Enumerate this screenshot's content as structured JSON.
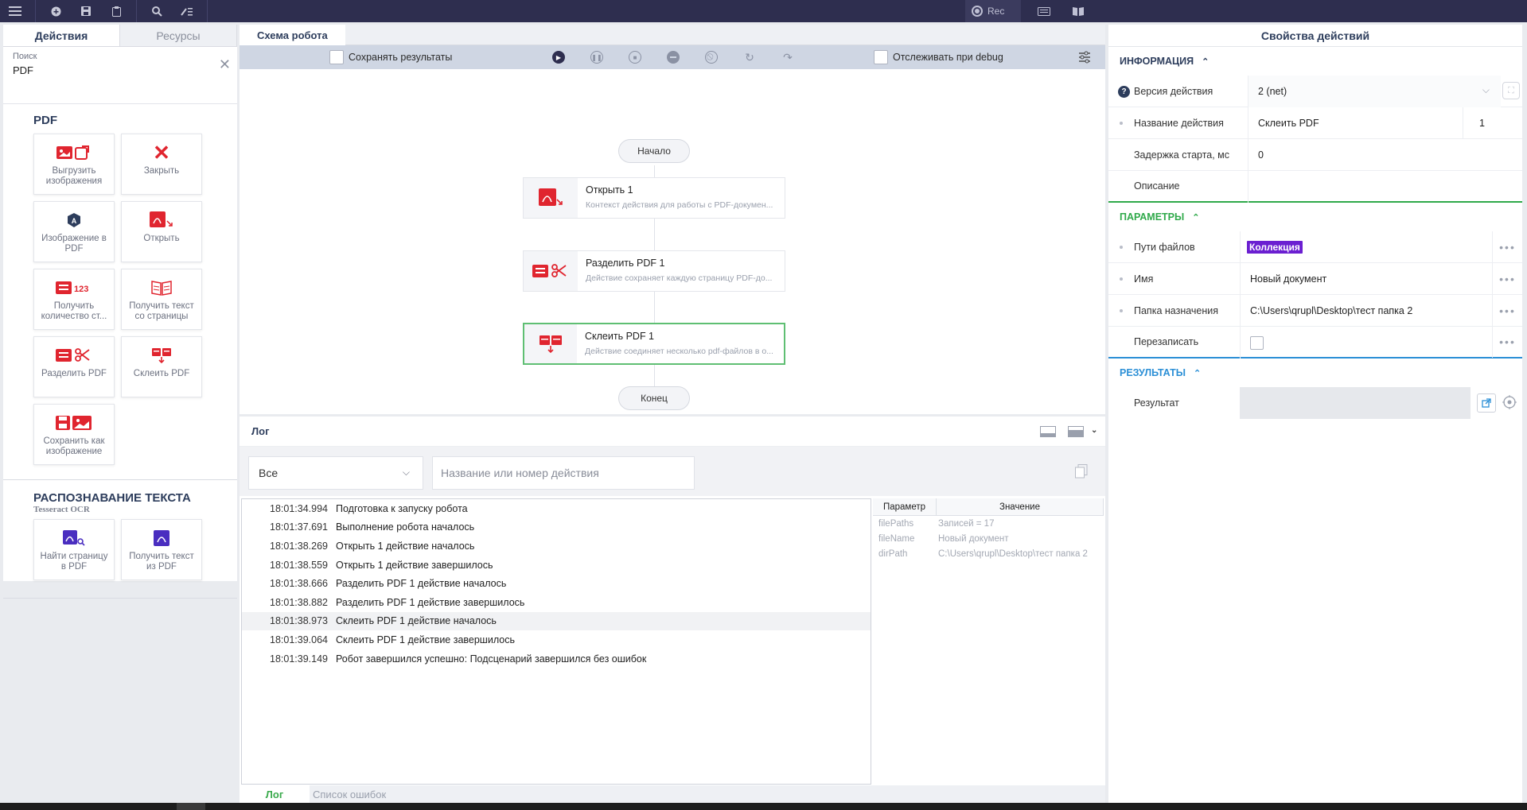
{
  "toolbar": {
    "rec_label": "Rec"
  },
  "left": {
    "tabs": [
      "Действия",
      "Ресурсы"
    ],
    "search_label": "Поиск",
    "search_value": "PDF",
    "pdf_section": "PDF",
    "pdf_tiles": [
      "Выгрузить изображения",
      "Закрыть",
      "Изображение в PDF",
      "Открыть",
      "Получить количество ст...",
      "Получить текст со страницы",
      "Разделить PDF",
      "Склеить PDF",
      "Сохранить как изображение"
    ],
    "ocr_section": "РАСПОЗНАВАНИЕ ТЕКСТА",
    "ocr_subtitle": "Tesseract OCR",
    "ocr_tiles": [
      "Найти страницу в PDF",
      "Получить текст из PDF"
    ],
    "count_badge": "123"
  },
  "schema": {
    "tab": "Схема робота",
    "save_results": "Сохранять результаты",
    "track_debug": "Отслеживать при debug",
    "start": "Начало",
    "end": "Конец",
    "nodes": [
      {
        "title": "Открыть  1",
        "desc": "Контекст действия для работы с PDF-докумен..."
      },
      {
        "title": "Разделить PDF  1",
        "desc": "Действие сохраняет каждую страницу PDF-до..."
      },
      {
        "title": "Склеить PDF  1",
        "desc": "Действие соединяет несколько pdf-файлов в о..."
      }
    ]
  },
  "log": {
    "title": "Лог",
    "filter_value": "Все",
    "search_placeholder": "Название или номер действия",
    "rows": [
      {
        "time": "18:01:34.994",
        "msg": "Подготовка к запуску робота"
      },
      {
        "time": "18:01:37.691",
        "msg": "Выполнение робота началось"
      },
      {
        "time": "18:01:38.269",
        "msg": "Открыть 1 действие началось"
      },
      {
        "time": "18:01:38.559",
        "msg": "Открыть 1 действие завершилось"
      },
      {
        "time": "18:01:38.666",
        "msg": "Разделить PDF 1 действие началось"
      },
      {
        "time": "18:01:38.882",
        "msg": "Разделить PDF 1 действие завершилось"
      },
      {
        "time": "18:01:38.973",
        "msg": "Склеить PDF 1 действие началось"
      },
      {
        "time": "18:01:39.064",
        "msg": "Склеить PDF 1 действие завершилось"
      },
      {
        "time": "18:01:39.149",
        "msg": "Робот завершился успешно: Подсценарий завершился без ошибок"
      }
    ],
    "param_header": "Параметр",
    "value_header": "Значение",
    "params": [
      {
        "name": "filePaths",
        "value": "Записей = 17"
      },
      {
        "name": "fileName",
        "value": "Новый документ"
      },
      {
        "name": "dirPath",
        "value": "C:\\Users\\qrupl\\Desktop\\тест папка 2"
      }
    ],
    "bottom_tabs": [
      "Лог",
      "Список ошибок"
    ]
  },
  "props": {
    "title": "Свойства действий",
    "info_section": "ИНФОРМАЦИЯ",
    "params_section": "ПАРАМЕТРЫ",
    "results_section": "РЕЗУЛЬТАТЫ",
    "version_label": "Версия действия",
    "version_value": "2 (net)",
    "name_label": "Название действия",
    "name_value": "Склеить PDF",
    "name_index": "1",
    "delay_label": "Задержка старта, мс",
    "delay_value": "0",
    "desc_label": "Описание",
    "paths_label": "Пути файлов",
    "paths_value": "Коллекция",
    "fname_label": "Имя",
    "fname_value": "Новый документ",
    "folder_label": "Папка назначения",
    "folder_value": "C:\\Users\\qrupl\\Desktop\\тест папка 2",
    "overwrite_label": "Перезаписать",
    "result_label": "Результат",
    "colors": {
      "info": "#2d3d5c",
      "params": "#2fa94a",
      "results": "#2b8fd6"
    }
  }
}
